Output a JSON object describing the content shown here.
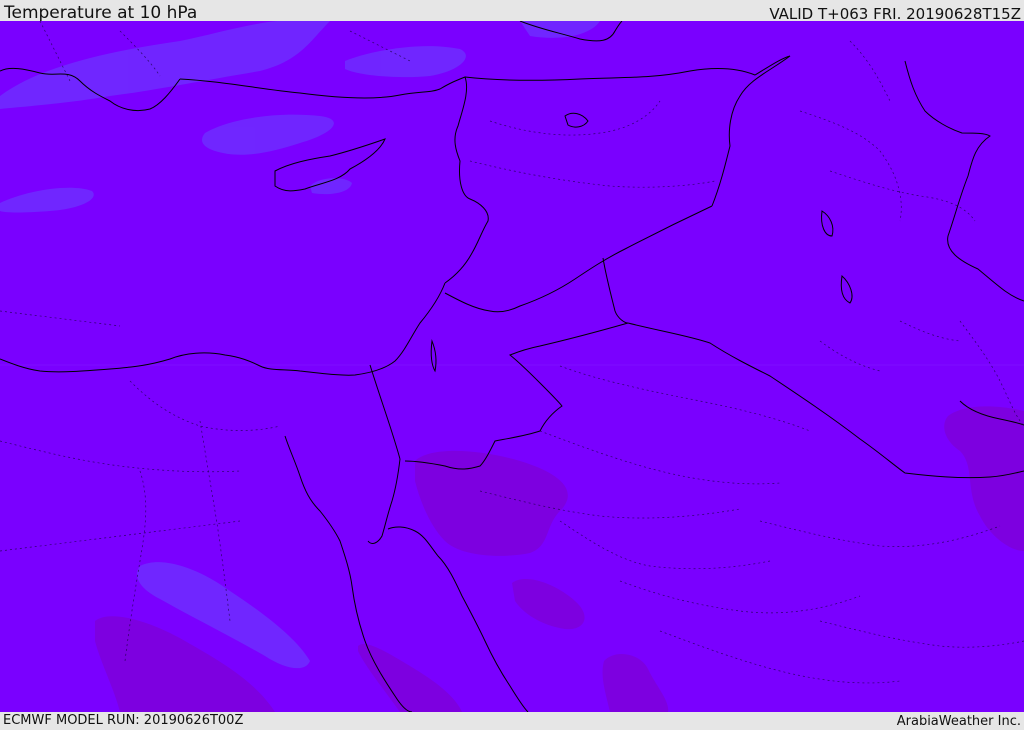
{
  "header": {
    "title": "Temperature at 10 hPa",
    "valid": "VALID T+063 FRI. 20190628T15Z"
  },
  "footer": {
    "model_run": "ECMWF MODEL RUN: 20190626T00Z",
    "brand": "ArabiaWeather Inc."
  },
  "colors": {
    "background_field": "#7a00ff",
    "cooler_field": "#6f2aff",
    "warmer_field": "#7d00e0",
    "coastline": "#000000"
  }
}
